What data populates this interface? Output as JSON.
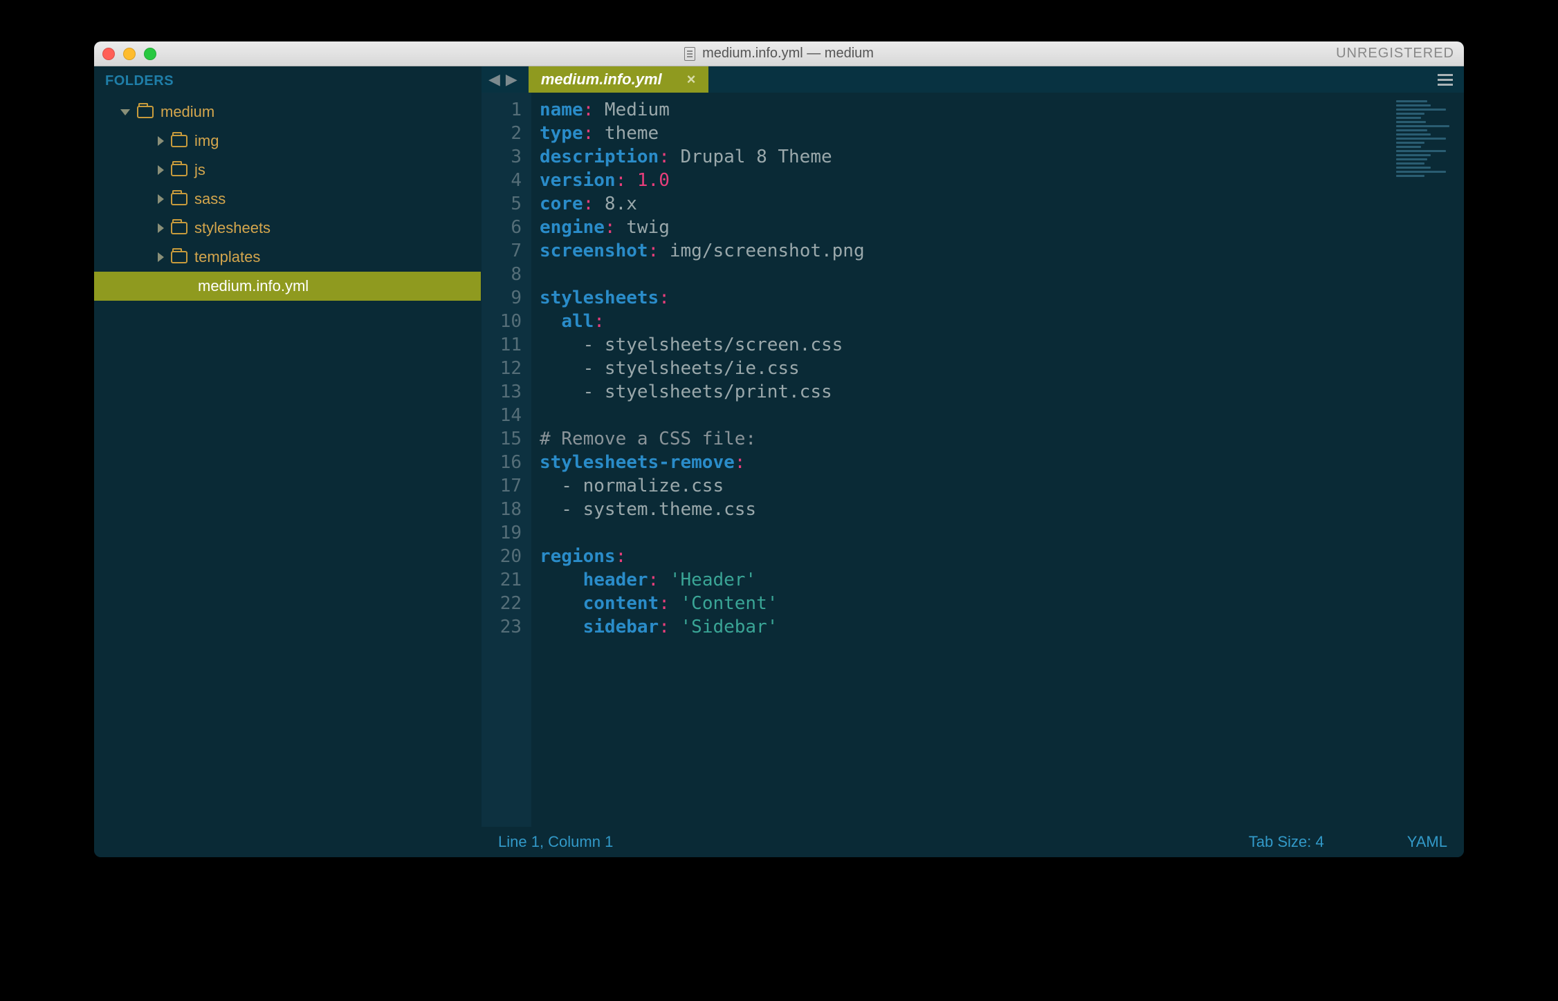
{
  "window": {
    "title": "medium.info.yml — medium",
    "registration": "UNREGISTERED"
  },
  "sidebar": {
    "header": "FOLDERS",
    "root": {
      "name": "medium",
      "expanded": true
    },
    "children": [
      {
        "name": "img"
      },
      {
        "name": "js"
      },
      {
        "name": "sass"
      },
      {
        "name": "stylesheets"
      },
      {
        "name": "templates"
      }
    ],
    "files": [
      {
        "name": "medium.info.yml",
        "selected": true
      }
    ]
  },
  "tabs": {
    "active": {
      "label": "medium.info.yml"
    }
  },
  "editor": {
    "lines": [
      {
        "n": 1,
        "tokens": [
          {
            "t": "name",
            "c": "key"
          },
          {
            "t": ":",
            "c": "punct"
          },
          {
            "t": " Medium",
            "c": "plain"
          }
        ]
      },
      {
        "n": 2,
        "tokens": [
          {
            "t": "type",
            "c": "key"
          },
          {
            "t": ":",
            "c": "punct"
          },
          {
            "t": " theme",
            "c": "plain"
          }
        ]
      },
      {
        "n": 3,
        "tokens": [
          {
            "t": "description",
            "c": "key"
          },
          {
            "t": ":",
            "c": "punct"
          },
          {
            "t": " Drupal 8 Theme",
            "c": "plain"
          }
        ]
      },
      {
        "n": 4,
        "tokens": [
          {
            "t": "version",
            "c": "key"
          },
          {
            "t": ":",
            "c": "punct"
          },
          {
            "t": " ",
            "c": "plain"
          },
          {
            "t": "1.0",
            "c": "num"
          }
        ]
      },
      {
        "n": 5,
        "tokens": [
          {
            "t": "core",
            "c": "key"
          },
          {
            "t": ":",
            "c": "punct"
          },
          {
            "t": " 8.x",
            "c": "plain"
          }
        ]
      },
      {
        "n": 6,
        "tokens": [
          {
            "t": "engine",
            "c": "key"
          },
          {
            "t": ":",
            "c": "punct"
          },
          {
            "t": " twig",
            "c": "plain"
          }
        ]
      },
      {
        "n": 7,
        "tokens": [
          {
            "t": "screenshot",
            "c": "key"
          },
          {
            "t": ":",
            "c": "punct"
          },
          {
            "t": " img/screenshot.png",
            "c": "plain"
          }
        ]
      },
      {
        "n": 8,
        "tokens": []
      },
      {
        "n": 9,
        "tokens": [
          {
            "t": "stylesheets",
            "c": "key"
          },
          {
            "t": ":",
            "c": "punct"
          }
        ]
      },
      {
        "n": 10,
        "tokens": [
          {
            "t": "  ",
            "c": "plain"
          },
          {
            "t": "all",
            "c": "key"
          },
          {
            "t": ":",
            "c": "punct"
          }
        ]
      },
      {
        "n": 11,
        "tokens": [
          {
            "t": "    - styelsheets/screen.css",
            "c": "plain"
          }
        ]
      },
      {
        "n": 12,
        "tokens": [
          {
            "t": "    - styelsheets/ie.css",
            "c": "plain"
          }
        ]
      },
      {
        "n": 13,
        "tokens": [
          {
            "t": "    - styelsheets/print.css",
            "c": "plain"
          }
        ]
      },
      {
        "n": 14,
        "tokens": []
      },
      {
        "n": 15,
        "tokens": [
          {
            "t": "# Remove a CSS file:",
            "c": "comment"
          }
        ]
      },
      {
        "n": 16,
        "tokens": [
          {
            "t": "stylesheets-remove",
            "c": "key"
          },
          {
            "t": ":",
            "c": "punct"
          }
        ]
      },
      {
        "n": 17,
        "tokens": [
          {
            "t": "  - normalize.css",
            "c": "plain"
          }
        ]
      },
      {
        "n": 18,
        "tokens": [
          {
            "t": "  - system.theme.css",
            "c": "plain"
          }
        ]
      },
      {
        "n": 19,
        "tokens": []
      },
      {
        "n": 20,
        "tokens": [
          {
            "t": "regions",
            "c": "key"
          },
          {
            "t": ":",
            "c": "punct"
          }
        ]
      },
      {
        "n": 21,
        "tokens": [
          {
            "t": "    ",
            "c": "plain"
          },
          {
            "t": "header",
            "c": "key"
          },
          {
            "t": ":",
            "c": "punct"
          },
          {
            "t": " ",
            "c": "plain"
          },
          {
            "t": "'Header'",
            "c": "str"
          }
        ]
      },
      {
        "n": 22,
        "tokens": [
          {
            "t": "    ",
            "c": "plain"
          },
          {
            "t": "content",
            "c": "key"
          },
          {
            "t": ":",
            "c": "punct"
          },
          {
            "t": " ",
            "c": "plain"
          },
          {
            "t": "'Content'",
            "c": "str"
          }
        ]
      },
      {
        "n": 23,
        "tokens": [
          {
            "t": "    ",
            "c": "plain"
          },
          {
            "t": "sidebar",
            "c": "key"
          },
          {
            "t": ":",
            "c": "punct"
          },
          {
            "t": " ",
            "c": "plain"
          },
          {
            "t": "'Sidebar'",
            "c": "str"
          }
        ]
      }
    ]
  },
  "status": {
    "position": "Line 1, Column 1",
    "tabsize": "Tab Size: 4",
    "syntax": "YAML"
  }
}
